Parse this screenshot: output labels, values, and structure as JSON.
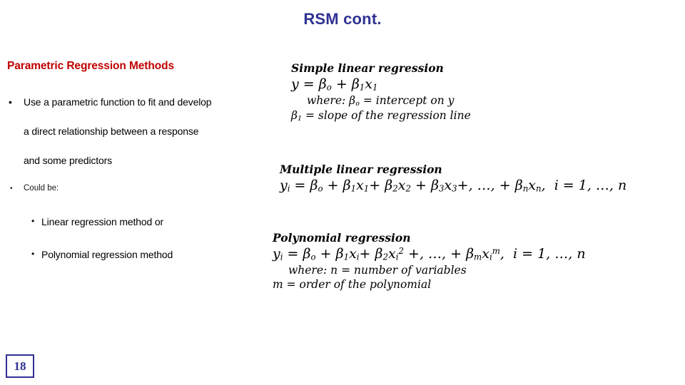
{
  "slide": {
    "title": "RSM cont.",
    "page_number": "18",
    "title_color": "#2F3192",
    "heading_color": "#C00000"
  },
  "left": {
    "section_heading": "Parametric Regression Methods",
    "bullet_marker": "•",
    "items": [
      {
        "kind": "bullet",
        "text": "Use a parametric function to fit and develop"
      },
      {
        "kind": "continuation",
        "text": "a direct relationship between a response"
      },
      {
        "kind": "continuation",
        "text": "and some predictors"
      },
      {
        "kind": "bullet-small",
        "text": "Could be:"
      },
      {
        "kind": "sub-bullet",
        "text": "Linear regression method or"
      },
      {
        "kind": "sub-bullet",
        "text": "Polynomial regression method"
      }
    ]
  },
  "math": {
    "simple": {
      "heading": "Simple linear regression",
      "equation": "y = βo + β1x1",
      "where_1": "where: βo = intercept on y",
      "where_2": "β1 = slope of the regression line"
    },
    "multiple": {
      "heading": "Multiple linear regression",
      "equation": "yi = βo + β1x1+ β2x2 + β3x3+, …, + βnxn,  i = 1, …, n"
    },
    "polynomial": {
      "heading": "Polynomial regression",
      "equation": "yi = βo + β1xi+ β2xi2 +, …, + βmxim,  i = 1, …, n",
      "where_1": "where: n = number of variables",
      "where_2": "m = order of the polynomial"
    }
  }
}
